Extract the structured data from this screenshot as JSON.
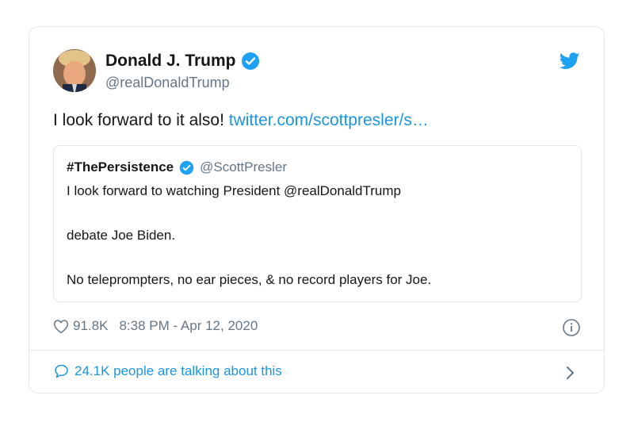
{
  "tweet": {
    "author_name": "Donald J. Trump",
    "author_handle": "@realDonaldTrump",
    "text": "I look forward to it also! ",
    "link_text": "twitter.com/scottpresler/s…",
    "likes": "91.8K",
    "timestamp": "8:38 PM - Apr 12, 2020",
    "talking_label": "24.1K people are talking about this"
  },
  "quote": {
    "author_name": "#ThePersistence",
    "author_handle": "@ScottPresler",
    "line1": "I look forward to watching President @realDonaldTrump",
    "line2": "debate Joe Biden.",
    "line3": "No teleprompters, no ear pieces, & no record players for Joe."
  },
  "colors": {
    "twitter_blue": "#1b95e0",
    "verified_blue": "#1da1f2",
    "secondary_text": "#657786",
    "border": "#e1e8ed"
  },
  "icons": {
    "brand": "twitter-bird-icon",
    "verified": "verified-badge-icon",
    "like": "heart-icon",
    "info": "info-icon",
    "comment": "speech-bubble-icon",
    "chevron": "chevron-right-icon"
  }
}
